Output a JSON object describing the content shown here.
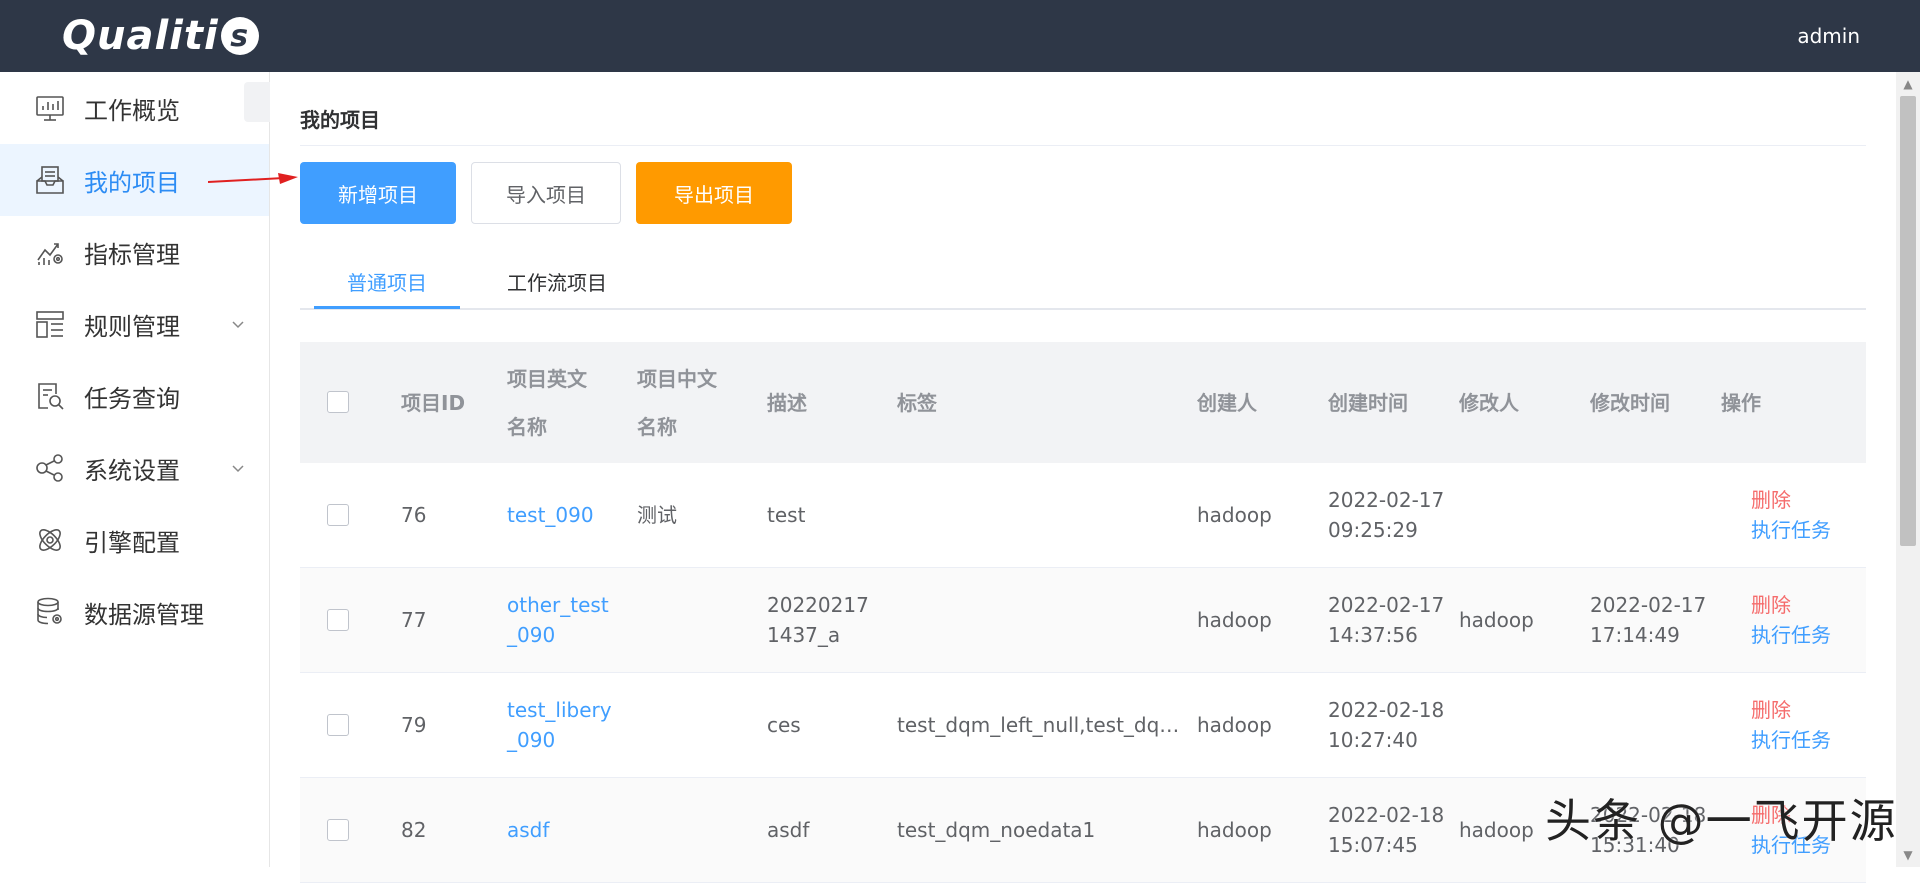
{
  "header": {
    "logo": "Qualiti",
    "logo_s": "s",
    "user": "admin"
  },
  "sidebar": {
    "items": [
      {
        "label": "工作概览"
      },
      {
        "label": "我的项目"
      },
      {
        "label": "指标管理"
      },
      {
        "label": "规则管理"
      },
      {
        "label": "任务查询"
      },
      {
        "label": "系统设置"
      },
      {
        "label": "引擎配置"
      },
      {
        "label": "数据源管理"
      }
    ]
  },
  "main": {
    "title": "我的项目",
    "buttons": {
      "add": "新增项目",
      "import": "导入项目",
      "export": "导出项目"
    },
    "tabs": [
      "普通项目",
      "工作流项目"
    ],
    "columns": [
      "项目ID",
      "项目英文名称",
      "项目中文名称",
      "描述",
      "标签",
      "创建人",
      "创建时间",
      "修改人",
      "修改时间",
      "操作"
    ],
    "rows": [
      {
        "id": "76",
        "en": "test_090",
        "cn": "测试",
        "desc": "test",
        "tags": "",
        "creator": "hadoop",
        "ctime": "2022-02-17 09:25:29",
        "modifier": "",
        "mtime": ""
      },
      {
        "id": "77",
        "en": "other_test_090",
        "cn": "",
        "desc": "202202171437_a",
        "tags": "",
        "creator": "hadoop",
        "ctime": "2022-02-17 14:37:56",
        "modifier": "hadoop",
        "mtime": "2022-02-17 17:14:49"
      },
      {
        "id": "79",
        "en": "test_libery_090",
        "cn": "",
        "desc": "ces",
        "tags": "test_dqm_left_null,test_dqm_…",
        "creator": "hadoop",
        "ctime": "2022-02-18 10:27:40",
        "modifier": "",
        "mtime": ""
      },
      {
        "id": "82",
        "en": "asdf",
        "cn": "",
        "desc": "asdf",
        "tags": "test_dqm_noedata1",
        "creator": "hadoop",
        "ctime": "2022-02-18 15:07:45",
        "modifier": "hadoop",
        "mtime": "2022-02-18 15:31:40"
      }
    ],
    "ops": {
      "delete": "删除",
      "run": "执行任务"
    }
  },
  "watermark": "头条 @一飞开源",
  "colors": {
    "primary": "#409eff",
    "warning": "#ff9a00",
    "danger": "#f56c6c",
    "header": "#2e3747"
  }
}
